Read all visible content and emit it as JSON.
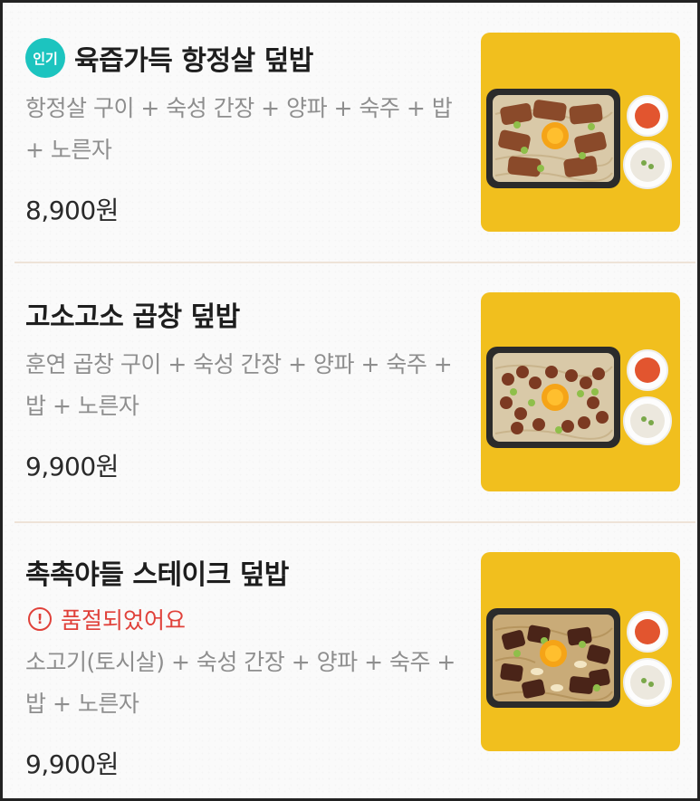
{
  "menu": {
    "items": [
      {
        "badge": "인기",
        "title": "육즙가득 항정살 덮밥",
        "description": "항정살 구이 + 숙성 간장 + 양파 + 숙주 + 밥 + 노른자",
        "price": "8,900원",
        "image_icon": "rice-bowl-image"
      },
      {
        "title": "고소고소 곱창 덮밥",
        "description": "훈연 곱창 구이 + 숙성 간장 + 양파 + 숙주 + 밥 + 노른자",
        "price": "9,900원",
        "image_icon": "rice-bowl-image"
      },
      {
        "title": "촉촉야들 스테이크 덮밥",
        "status": "품절되었어요",
        "description": "소고기(토시살) + 숙성 간장 + 양파 + 숙주 + 밥 + 노른자",
        "price": "9,900원",
        "image_icon": "rice-bowl-image"
      }
    ]
  },
  "colors": {
    "badge_bg": "#1cc4bf",
    "thumbnail_bg": "#f1bf1e",
    "soldout_text": "#e0413a",
    "description_text": "#8e8e8e"
  }
}
